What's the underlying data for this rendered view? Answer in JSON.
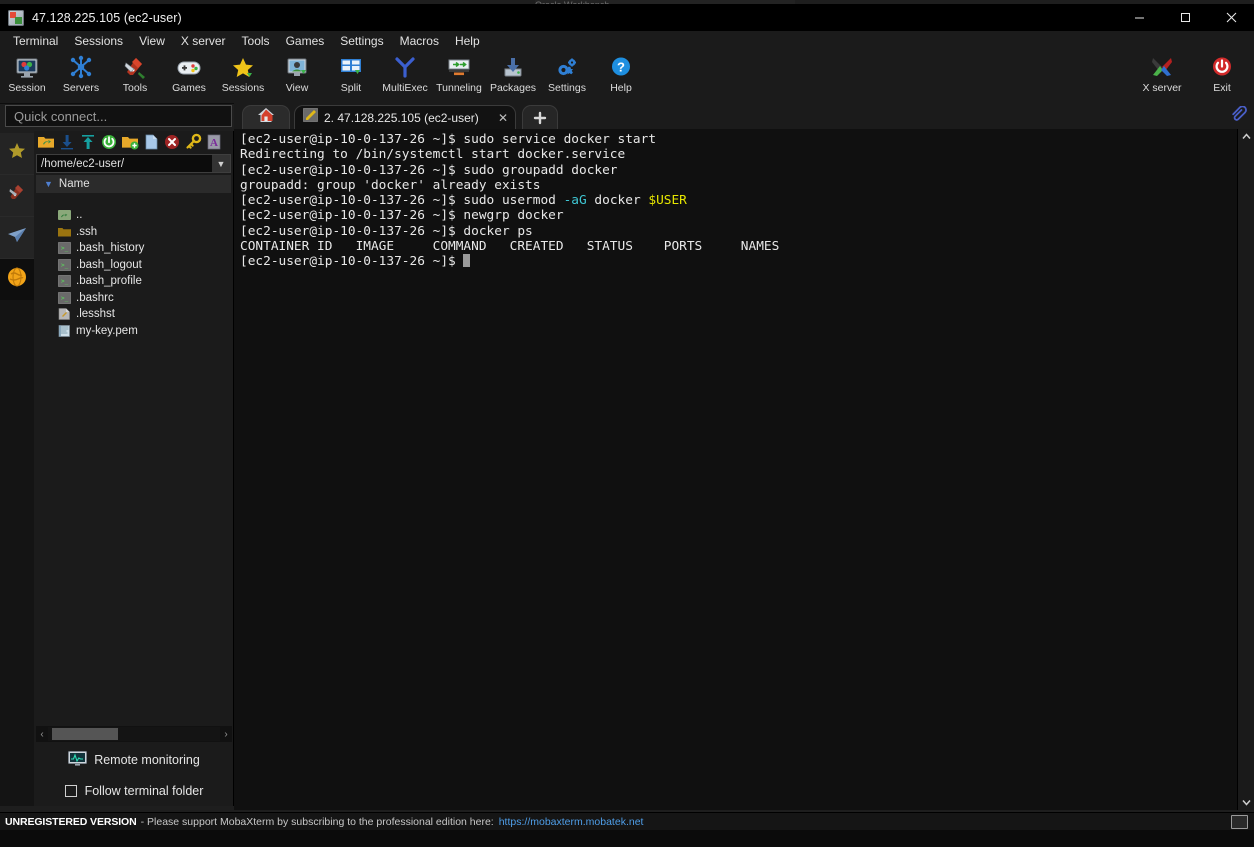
{
  "window": {
    "title": "47.128.225.105 (ec2-user)",
    "icon": "mobaxterm-session-icon",
    "minimize": "─",
    "maximize": "☐",
    "close": "✕",
    "ghost_title": "Oracle  Workbench"
  },
  "menubar": {
    "items": [
      {
        "label": "Terminal",
        "name": "menu-terminal"
      },
      {
        "label": "Sessions",
        "name": "menu-sessions"
      },
      {
        "label": "View",
        "name": "menu-view"
      },
      {
        "label": "X server",
        "name": "menu-xserver"
      },
      {
        "label": "Tools",
        "name": "menu-tools"
      },
      {
        "label": "Games",
        "name": "menu-games"
      },
      {
        "label": "Settings",
        "name": "menu-settings"
      },
      {
        "label": "Macros",
        "name": "menu-macros"
      },
      {
        "label": "Help",
        "name": "menu-help"
      }
    ]
  },
  "toolbar": {
    "left_items": [
      {
        "label": "Session",
        "icon": "session-icon"
      },
      {
        "label": "Servers",
        "icon": "servers-icon"
      },
      {
        "label": "Tools",
        "icon": "tools-icon"
      },
      {
        "label": "Games",
        "icon": "games-icon"
      },
      {
        "label": "Sessions",
        "icon": "sessions-star-icon"
      },
      {
        "label": "View",
        "icon": "view-icon"
      },
      {
        "label": "Split",
        "icon": "split-icon"
      },
      {
        "label": "MultiExec",
        "icon": "multiexec-icon"
      },
      {
        "label": "Tunneling",
        "icon": "tunneling-icon"
      },
      {
        "label": "Packages",
        "icon": "packages-icon"
      },
      {
        "label": "Settings",
        "icon": "settings-gear-icon"
      },
      {
        "label": "Help",
        "icon": "help-icon"
      }
    ],
    "right_items": [
      {
        "label": "X server",
        "icon": "xserver-icon"
      },
      {
        "label": "Exit",
        "icon": "exit-power-icon"
      }
    ]
  },
  "quick_connect": {
    "placeholder": "Quick connect..."
  },
  "rail": {
    "items": [
      {
        "name": "sidebar-rail-favorites",
        "icon": "star-icon"
      },
      {
        "name": "sidebar-rail-tools",
        "icon": "swiss-knife-icon"
      },
      {
        "name": "sidebar-rail-sftp",
        "icon": "paper-plane-icon"
      },
      {
        "name": "sidebar-rail-macros",
        "icon": "globe-icon"
      }
    ]
  },
  "sftp": {
    "tools": [
      {
        "name": "sftp-parent-folder-button",
        "icon": "up-folder-icon"
      },
      {
        "name": "sftp-download-button",
        "icon": "download-icon"
      },
      {
        "name": "sftp-upload-button",
        "icon": "upload-icon"
      },
      {
        "name": "sftp-refresh-button",
        "icon": "refresh-icon"
      },
      {
        "name": "sftp-new-folder-button",
        "icon": "new-folder-icon"
      },
      {
        "name": "sftp-new-file-button",
        "icon": "new-file-icon"
      },
      {
        "name": "sftp-delete-button",
        "icon": "delete-icon"
      },
      {
        "name": "sftp-permissions-button",
        "icon": "key-icon"
      },
      {
        "name": "sftp-text-editor-button",
        "icon": "text-editor-icon"
      }
    ],
    "path": "/home/ec2-user/",
    "column_header": "Name",
    "files": [
      {
        "name": "..",
        "icon": "parent-dir-icon"
      },
      {
        "name": ".ssh",
        "icon": "folder-icon"
      },
      {
        "name": ".bash_history",
        "icon": "script-file-icon"
      },
      {
        "name": ".bash_logout",
        "icon": "script-file-icon"
      },
      {
        "name": ".bash_profile",
        "icon": "script-file-icon"
      },
      {
        "name": ".bashrc",
        "icon": "script-file-icon"
      },
      {
        "name": ".lesshst",
        "icon": "text-file-icon"
      },
      {
        "name": "my-key.pem",
        "icon": "certificate-file-icon"
      }
    ],
    "remote_monitoring": "Remote monitoring",
    "follow_terminal_folder": "Follow terminal folder",
    "follow_checked": false,
    "scroll_left_arrow": "‹",
    "scroll_right_arrow": "›"
  },
  "tabs": {
    "home_icon": "home-icon",
    "items": [
      {
        "label": "2. 47.128.225.105 (ec2-user)",
        "icon": "ssh-session-icon",
        "active": true,
        "close": "✕"
      }
    ],
    "new_tab_label": "+",
    "clipboard_icon": "paperclip-icon"
  },
  "terminal": {
    "prompt": "[ec2-user@ip-10-0-137-26 ~]$ ",
    "lines": [
      [
        {
          "t": "[ec2-user@ip-10-0-137-26 ~]$ sudo service docker start",
          "c": "w"
        }
      ],
      [
        {
          "t": "Redirecting to /bin/systemctl start docker.service",
          "c": "w"
        }
      ],
      [
        {
          "t": "[ec2-user@ip-10-0-137-26 ~]$ sudo groupadd docker",
          "c": "w"
        }
      ],
      [
        {
          "t": "groupadd: group 'docker' already exists",
          "c": "w"
        }
      ],
      [
        {
          "t": "[ec2-user@ip-10-0-137-26 ~]$ sudo usermod ",
          "c": "w"
        },
        {
          "t": "-aG",
          "c": "c"
        },
        {
          "t": " docker ",
          "c": "w"
        },
        {
          "t": "$USER",
          "c": "y"
        }
      ],
      [
        {
          "t": "[ec2-user@ip-10-0-137-26 ~]$ newgrp docker",
          "c": "w"
        }
      ],
      [
        {
          "t": "[ec2-user@ip-10-0-137-26 ~]$ docker ps",
          "c": "w"
        }
      ],
      [
        {
          "t": "CONTAINER ID   IMAGE     COMMAND   CREATED   STATUS    PORTS     NAMES",
          "c": "w"
        }
      ],
      [
        {
          "t": "[ec2-user@ip-10-0-137-26 ~]$ ",
          "c": "w"
        },
        {
          "t": "█",
          "c": "cursor"
        }
      ]
    ],
    "scroll_up_arrow": "⌃",
    "scroll_down_arrow": "⌄"
  },
  "statusbar": {
    "unregistered": "UNREGISTERED VERSION",
    "message": "-  Please support MobaXterm by subscribing to the professional edition here:",
    "link": "https://mobaxterm.mobatek.net",
    "monitor_icon": "display-icon"
  },
  "colors": {
    "accent_blue": "#4f9ee8",
    "terminal_bg": "#101010",
    "terminal_fg": "#e6e6e6",
    "cyan": "#3fc7d4",
    "yellow": "#e6e600",
    "window_bg": "#1b1b1b",
    "exit_red": "#d22b2b"
  }
}
